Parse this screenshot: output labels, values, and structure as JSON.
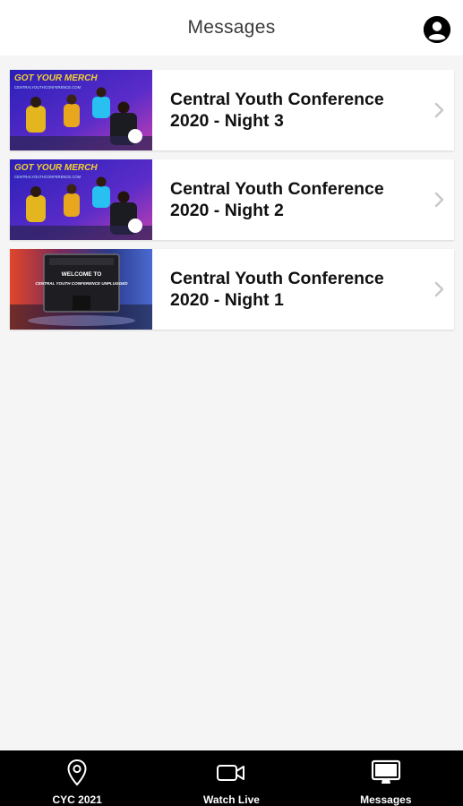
{
  "header": {
    "title": "Messages",
    "profile_icon": "user-circle-icon"
  },
  "messages": [
    {
      "title_line1": "Central Youth Conference",
      "title_line2": "2020 - Night 3",
      "thumbnail": "merch-promo",
      "thumb_text": "GOT YOUR MERCH",
      "thumb_sub": "CENTRALYOUTHCONFERENCE.COM"
    },
    {
      "title_line1": "Central Youth Conference",
      "title_line2": "2020 - Night 2",
      "thumbnail": "merch-promo",
      "thumb_text": "GOT YOUR MERCH",
      "thumb_sub": "CENTRALYOUTHCONFERENCE.COM"
    },
    {
      "title_line1": "Central Youth Conference",
      "title_line2": "2020 - Night 1",
      "thumbnail": "welcome-amp",
      "thumb_text": "WELCOME TO",
      "thumb_sub": "CENTRAL YOUTH CONFERENCE UNPLUGGED"
    }
  ],
  "tabs": [
    {
      "label": "CYC 2021",
      "icon": "map-pin-icon",
      "active": false
    },
    {
      "label": "Watch Live",
      "icon": "video-camera-icon",
      "active": false
    },
    {
      "label": "Messages",
      "icon": "monitor-icon",
      "active": true
    }
  ],
  "colors": {
    "header_bg": "#ffffff",
    "background": "#f5f5f5",
    "tabbar_bg": "#000000",
    "chevron": "#c7c7cc",
    "promo_purple": "#3b1d8f",
    "promo_yellow": "#f2d22e",
    "promo_blue": "#27c0f0"
  }
}
